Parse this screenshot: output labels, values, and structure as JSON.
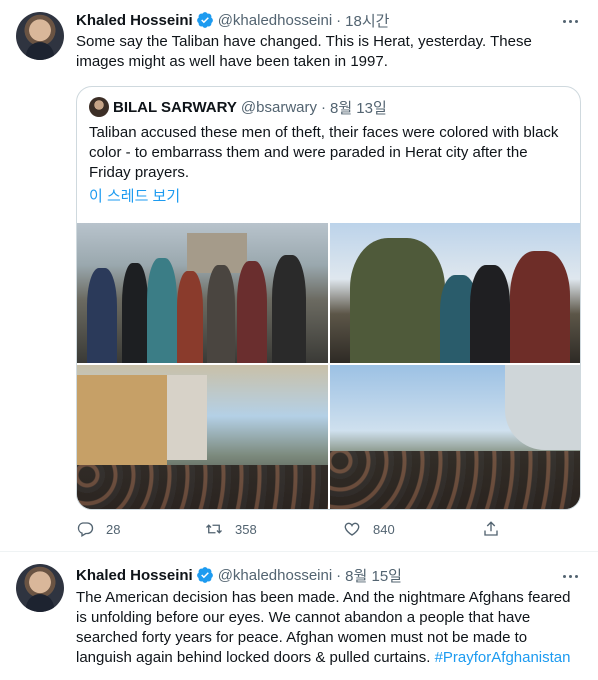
{
  "tweets": [
    {
      "author": "Khaled Hosseini",
      "handle": "@khaledhosseini",
      "time": "18시간",
      "text": "Some say the Taliban have changed. This is Herat, yesterday. These images might as well have been taken in 1997.",
      "quote": {
        "author": "BILAL SARWARY",
        "handle": "@bsarwary",
        "time": "8월 13일",
        "text": "Taliban accused these men of theft, their faces were colored with black color - to embarrass them and were paraded in Herat city after the Friday prayers.",
        "thread_link": "이 스레드 보기"
      },
      "actions": {
        "reply_count": "28",
        "retweet_count": "358",
        "like_count": "840"
      }
    },
    {
      "author": "Khaled Hosseini",
      "handle": "@khaledhosseini",
      "time": "8월 15일",
      "text": "The American decision has been made. And the nightmare Afghans feared is unfolding before our eyes. We cannot abandon a people that have searched forty years for peace. Afghan women must not be made to languish again behind locked doors & pulled curtains.",
      "hashtag": "#PrayforAfghanistan"
    }
  ],
  "dot": "·",
  "colors": {
    "accent": "#1d9bf0",
    "secondary_text": "#536471",
    "border": "#cfd9de"
  },
  "icons": {
    "verified": "verified-badge-icon",
    "more": "more-dots-icon",
    "reply": "reply-icon",
    "retweet": "retweet-icon",
    "like": "heart-icon",
    "share": "share-icon"
  }
}
